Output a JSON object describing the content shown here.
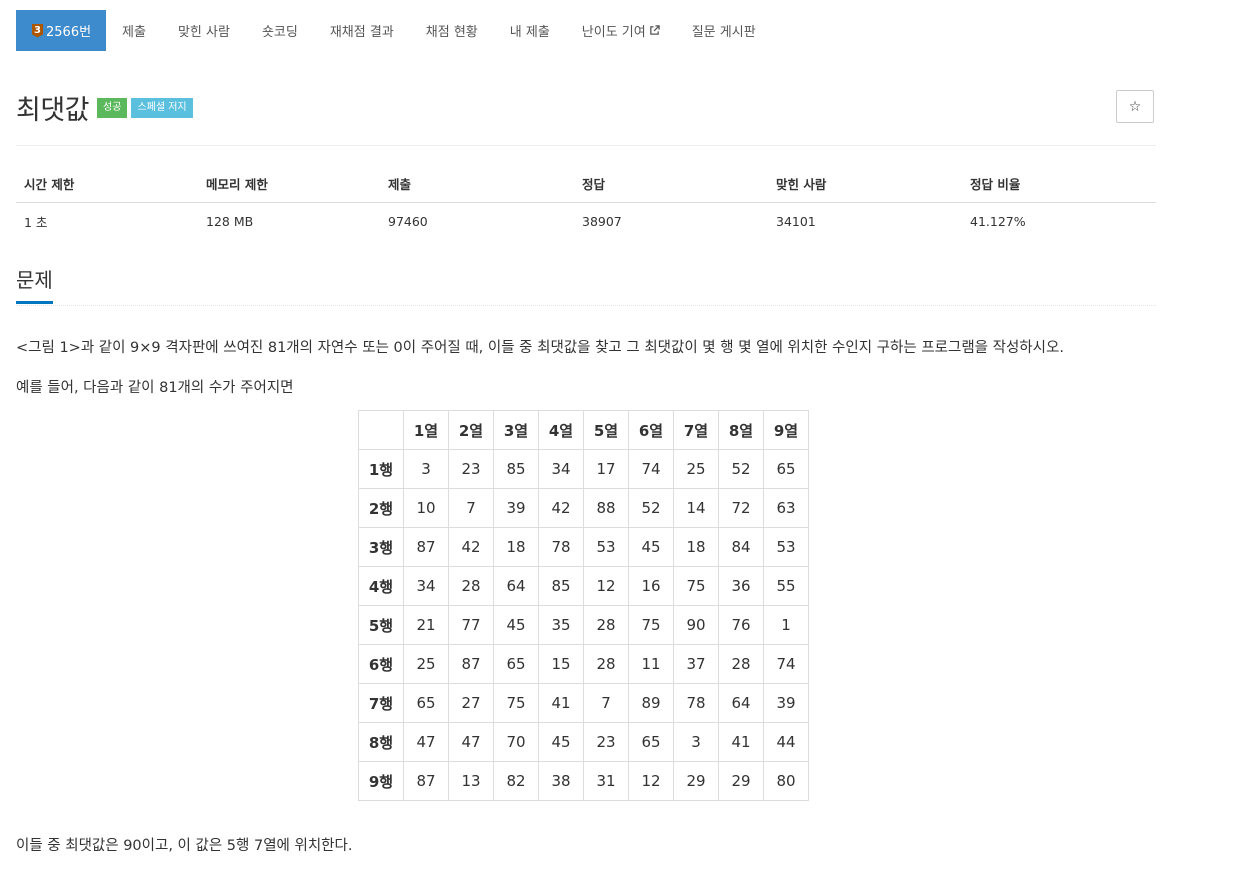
{
  "nav": {
    "problem_number": "2566번",
    "tier_mark": "3",
    "items": [
      "제출",
      "맞힌 사람",
      "숏코딩",
      "재채점 결과",
      "채점 현황",
      "내 제출",
      "난이도 기여",
      "질문 게시판"
    ]
  },
  "problem": {
    "title": "최댓값",
    "badge_result": "성공",
    "badge_judge": "스페셜 저지",
    "star": "☆"
  },
  "info": {
    "headers": [
      "시간 제한",
      "메모리 제한",
      "제출",
      "정답",
      "맞힌 사람",
      "정답 비율"
    ],
    "values": [
      "1 초",
      "128 MB",
      "97460",
      "38907",
      "34101",
      "41.127%"
    ]
  },
  "section": {
    "heading": "문제",
    "p1": "<그림 1>과 같이 9×9 격자판에 쓰여진 81개의 자연수 또는 0이 주어질 때, 이들 중 최댓값을 찾고 그 최댓값이 몇 행 몇 열에 위치한 수인지 구하는 프로그램을 작성하시오.",
    "p2": "예를 들어, 다음과 같이 81개의 수가 주어지면",
    "p3": "이들 중 최댓값은 90이고, 이 값은 5행 7열에 위치한다."
  },
  "grid": {
    "col_headers": [
      "1열",
      "2열",
      "3열",
      "4열",
      "5열",
      "6열",
      "7열",
      "8열",
      "9열"
    ],
    "rows": [
      {
        "label": "1행",
        "cells": [
          "3",
          "23",
          "85",
          "34",
          "17",
          "74",
          "25",
          "52",
          "65"
        ]
      },
      {
        "label": "2행",
        "cells": [
          "10",
          "7",
          "39",
          "42",
          "88",
          "52",
          "14",
          "72",
          "63"
        ]
      },
      {
        "label": "3행",
        "cells": [
          "87",
          "42",
          "18",
          "78",
          "53",
          "45",
          "18",
          "84",
          "53"
        ]
      },
      {
        "label": "4행",
        "cells": [
          "34",
          "28",
          "64",
          "85",
          "12",
          "16",
          "75",
          "36",
          "55"
        ]
      },
      {
        "label": "5행",
        "cells": [
          "21",
          "77",
          "45",
          "35",
          "28",
          "75",
          "90",
          "76",
          "1"
        ]
      },
      {
        "label": "6행",
        "cells": [
          "25",
          "87",
          "65",
          "15",
          "28",
          "11",
          "37",
          "28",
          "74"
        ]
      },
      {
        "label": "7행",
        "cells": [
          "65",
          "27",
          "75",
          "41",
          "7",
          "89",
          "78",
          "64",
          "39"
        ]
      },
      {
        "label": "8행",
        "cells": [
          "47",
          "47",
          "70",
          "45",
          "23",
          "65",
          "3",
          "41",
          "44"
        ]
      },
      {
        "label": "9행",
        "cells": [
          "87",
          "13",
          "82",
          "38",
          "31",
          "12",
          "29",
          "29",
          "80"
        ]
      }
    ]
  }
}
